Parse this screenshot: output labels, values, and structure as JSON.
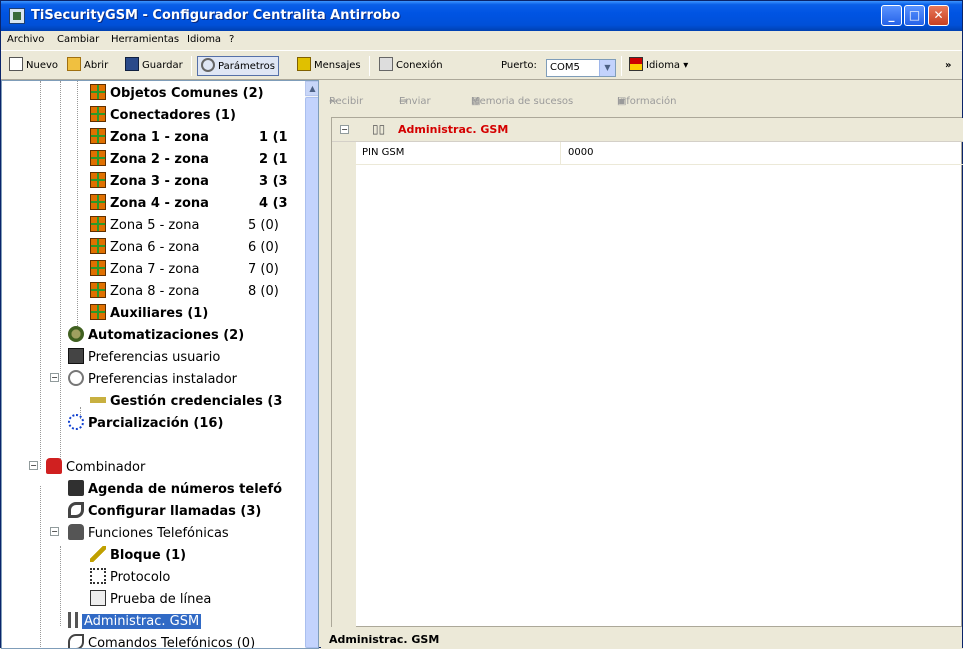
{
  "window": {
    "title": "TiSecurityGSM - Configurador Centralita Antirrobo",
    "minimize": "_",
    "maximize": "□",
    "close": "✕"
  },
  "menu": [
    "Archivo",
    "Cambiar",
    "Herramientas",
    "Idioma",
    "?"
  ],
  "toolbar": {
    "nuevo": "Nuevo",
    "abrir": "Abrir",
    "guardar": "Guardar",
    "parametros": "Parámetros",
    "mensajes": "Mensajes",
    "conexion": "Conexión",
    "puerto_label": "Puerto:",
    "puerto_value": "COM5",
    "idioma": "Idioma",
    "overflow": "»"
  },
  "tree": {
    "items": [
      {
        "label": "Objetos Comunes (2)",
        "count": ""
      },
      {
        "label": "Conectadores (1)",
        "count": ""
      },
      {
        "label": "Zona 1 - zona",
        "count": "1 (1"
      },
      {
        "label": "Zona 2 - zona",
        "count": "2 (1"
      },
      {
        "label": "Zona 3 - zona",
        "count": "3 (3"
      },
      {
        "label": "Zona 4 - zona",
        "count": "4 (3"
      },
      {
        "label": "Zona 5 - zona",
        "count": "5 (0)"
      },
      {
        "label": "Zona 6 - zona",
        "count": "6 (0)"
      },
      {
        "label": "Zona 7 - zona",
        "count": "7 (0)"
      },
      {
        "label": "Zona 8 - zona",
        "count": "8 (0)"
      },
      {
        "label": "Auxiliares (1)",
        "count": ""
      },
      {
        "label": "Automatizaciones (2)",
        "count": ""
      },
      {
        "label": "Preferencias usuario",
        "count": ""
      },
      {
        "label": "Preferencias instalador",
        "count": ""
      },
      {
        "label": "Gestión credenciales (3",
        "count": ""
      },
      {
        "label": "Parcialización (16)",
        "count": ""
      },
      {
        "label": "Combinador",
        "count": ""
      },
      {
        "label": "Agenda de números telefó",
        "count": ""
      },
      {
        "label": "Configurar llamadas (3)",
        "count": ""
      },
      {
        "label": "Funciones Telefónicas",
        "count": ""
      },
      {
        "label": "Bloque (1)",
        "count": ""
      },
      {
        "label": "Protocolo",
        "count": ""
      },
      {
        "label": "Prueba de línea",
        "count": ""
      },
      {
        "label": "Administrac. GSM",
        "count": ""
      },
      {
        "label": "Comandos Telefónicos (0)",
        "count": ""
      }
    ]
  },
  "right": {
    "toolbar": [
      "Recibir",
      "Enviar",
      "Memoria de sucesos",
      "Información"
    ],
    "category": "Administrac. GSM",
    "row": {
      "name": "PIN GSM",
      "value": "0000"
    },
    "description": "Administrac. GSM"
  },
  "colors": {
    "title_blue": "#0054e3",
    "category_red": "#d40000",
    "selection": "#316ac5"
  }
}
